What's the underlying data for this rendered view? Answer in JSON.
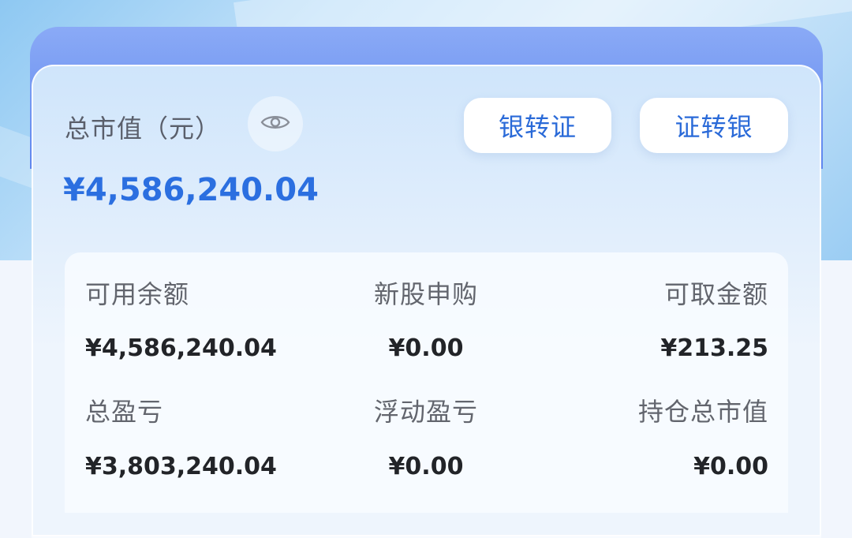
{
  "header": {
    "total_label": "总市值（元）",
    "total_value": "¥4,586,240.04",
    "eye_icon": "eye-icon"
  },
  "actions": {
    "bank_to_securities": "银转证",
    "securities_to_bank": "证转银"
  },
  "stats": {
    "available_balance": {
      "label": "可用余额",
      "value": "¥4,586,240.04"
    },
    "ipo_subscription": {
      "label": "新股申购",
      "value": "¥0.00"
    },
    "withdrawable": {
      "label": "可取金额",
      "value": "¥213.25"
    },
    "total_pnl": {
      "label": "总盈亏",
      "value": "¥3,803,240.04"
    },
    "floating_pnl": {
      "label": "浮动盈亏",
      "value": "¥0.00"
    },
    "position_value": {
      "label": "持仓总市值",
      "value": "¥0.00"
    }
  },
  "colors": {
    "accent": "#2b6fe0",
    "card_header": "#5f86ee",
    "text_primary": "#222428",
    "text_secondary": "#62656d"
  }
}
